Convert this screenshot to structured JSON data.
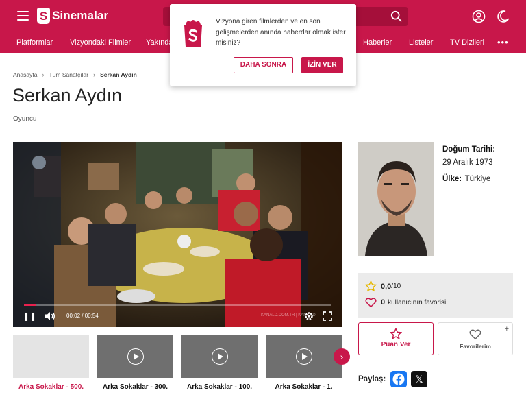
{
  "header": {
    "logo_text": "Sinemalar",
    "logo_letter": "S",
    "nav": [
      "Platformlar",
      "Vizyondaki Filmler",
      "Yakında",
      "Haberler",
      "Listeler",
      "TV Dizileri"
    ],
    "nav_more": "•••"
  },
  "breadcrumb": [
    "Anasayfa",
    "Tüm Sanatçılar",
    "Serkan Aydın"
  ],
  "person": {
    "name": "Serkan Aydın",
    "role": "Oyuncu",
    "birth_label": "Doğum Tarihi:",
    "birth_value": "29 Aralık 1973",
    "country_label": "Ülke:",
    "country_value": "Türkiye"
  },
  "video": {
    "current_time": "00:02",
    "duration": "00:54",
    "progress": 0.037,
    "watermark": "KANALD.COM.TR | KANAL D"
  },
  "thumbs": [
    {
      "label": "Arka Sokaklar - 500.",
      "active": true,
      "empty": true
    },
    {
      "label": "Arka Sokaklar - 300.",
      "active": false,
      "empty": false
    },
    {
      "label": "Arka Sokaklar - 100.",
      "active": false,
      "empty": false
    },
    {
      "label": "Arka Sokaklar - 1.",
      "active": false,
      "empty": false
    }
  ],
  "rating": {
    "score": "0,0",
    "max": "/10",
    "fav_count": "0",
    "fav_text": "kullanıcının favorisi"
  },
  "actions": {
    "rate_label": "Puan Ver",
    "fav_label": "Favorilerim",
    "fav_plus": "+"
  },
  "share": {
    "label": "Paylaş:",
    "x_glyph": "𝕏"
  },
  "popup": {
    "message": "Vizyona giren filmlerden ve en son gelişmelerden anında haberdar olmak ister misiniz?",
    "later_label": "DAHA SONRA",
    "allow_label": "İZİN VER"
  },
  "colors": {
    "brand": "#c8174a",
    "facebook": "#1877f2"
  }
}
